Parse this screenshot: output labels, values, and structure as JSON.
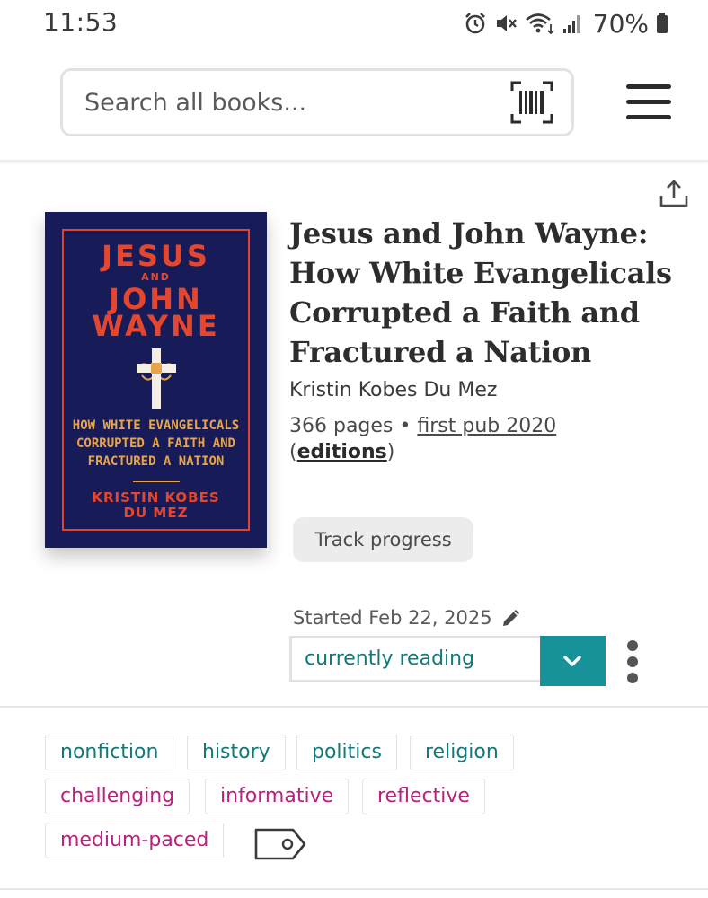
{
  "status_bar": {
    "time": "11:53",
    "battery": "70%",
    "icons": [
      "alarm-icon",
      "mute-icon",
      "wifi-icon",
      "signal-icon",
      "battery-icon"
    ]
  },
  "header": {
    "search_placeholder": "Search all books...",
    "icons": [
      "barcode-scanner-icon",
      "hamburger-menu-icon"
    ]
  },
  "book": {
    "cover": {
      "title_line1": "JESUS",
      "title_and": "AND",
      "title_line2": "JOHN",
      "title_line3": "WAYNE",
      "subtitle_line1": "HOW WHITE EVANGELICALS",
      "subtitle_line2": "CORRUPTED A FAITH AND",
      "subtitle_line3": "FRACTURED A NATION",
      "author_line1": "KRISTIN KOBES",
      "author_line2": "DU MEZ",
      "background": "#171c58",
      "accent": "#e4472d"
    },
    "title": "Jesus and John Wayne: How White Evangelicals Corrupted a Faith and Fractured a Nation",
    "author": "Kristin Kobes Du Mez",
    "pages": "366 pages",
    "separator": "•",
    "first_pub": "first pub 2020",
    "editions_open": "(",
    "editions": "editions",
    "editions_close": ")",
    "track_progress": "Track progress",
    "started": "Started Feb 22, 2025",
    "shelf_status": "currently reading"
  },
  "tags": {
    "genres": [
      "nonfiction",
      "history",
      "politics",
      "religion"
    ],
    "moods": [
      "challenging",
      "informative",
      "reflective"
    ],
    "pace": "medium-paced",
    "genre_color": "#12797b",
    "mood_color": "#b8227e"
  },
  "colors": {
    "accent_teal": "#189299"
  }
}
